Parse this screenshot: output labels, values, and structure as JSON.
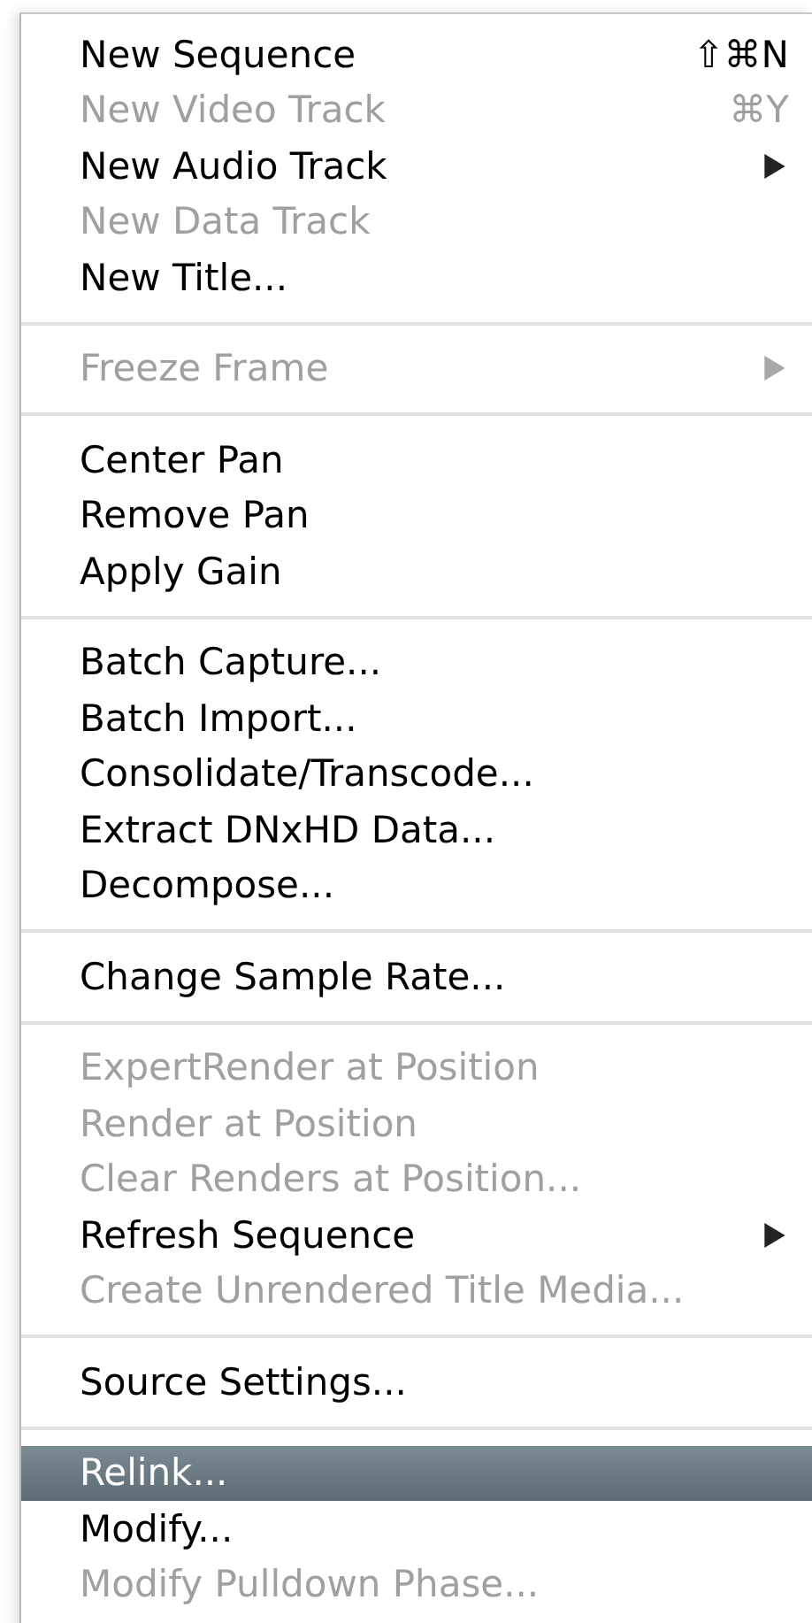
{
  "menu": {
    "items": [
      {
        "kind": "item",
        "label": "New Sequence",
        "shortcut": "⇧⌘N",
        "submenu": false,
        "disabled": false,
        "selected": false
      },
      {
        "kind": "item",
        "label": "New Video Track",
        "shortcut": "⌘Y",
        "submenu": false,
        "disabled": true,
        "selected": false
      },
      {
        "kind": "item",
        "label": "New Audio Track",
        "submenu": true,
        "disabled": false,
        "selected": false
      },
      {
        "kind": "item",
        "label": "New Data Track",
        "submenu": false,
        "disabled": true,
        "selected": false
      },
      {
        "kind": "item",
        "label": "New Title...",
        "submenu": false,
        "disabled": false,
        "selected": false
      },
      {
        "kind": "separator"
      },
      {
        "kind": "item",
        "label": "Freeze Frame",
        "submenu": true,
        "disabled": true,
        "selected": false
      },
      {
        "kind": "separator"
      },
      {
        "kind": "item",
        "label": "Center Pan",
        "submenu": false,
        "disabled": false,
        "selected": false
      },
      {
        "kind": "item",
        "label": "Remove Pan",
        "submenu": false,
        "disabled": false,
        "selected": false
      },
      {
        "kind": "item",
        "label": "Apply Gain",
        "submenu": false,
        "disabled": false,
        "selected": false
      },
      {
        "kind": "separator"
      },
      {
        "kind": "item",
        "label": "Batch Capture...",
        "submenu": false,
        "disabled": false,
        "selected": false
      },
      {
        "kind": "item",
        "label": "Batch Import...",
        "submenu": false,
        "disabled": false,
        "selected": false
      },
      {
        "kind": "item",
        "label": "Consolidate/Transcode...",
        "submenu": false,
        "disabled": false,
        "selected": false
      },
      {
        "kind": "item",
        "label": "Extract DNxHD Data...",
        "submenu": false,
        "disabled": false,
        "selected": false
      },
      {
        "kind": "item",
        "label": "Decompose...",
        "submenu": false,
        "disabled": false,
        "selected": false
      },
      {
        "kind": "separator"
      },
      {
        "kind": "item",
        "label": "Change Sample Rate...",
        "submenu": false,
        "disabled": false,
        "selected": false
      },
      {
        "kind": "separator"
      },
      {
        "kind": "item",
        "label": "ExpertRender at Position",
        "submenu": false,
        "disabled": true,
        "selected": false
      },
      {
        "kind": "item",
        "label": "Render at Position",
        "submenu": false,
        "disabled": true,
        "selected": false
      },
      {
        "kind": "item",
        "label": "Clear Renders at Position...",
        "submenu": false,
        "disabled": true,
        "selected": false
      },
      {
        "kind": "item",
        "label": "Refresh Sequence",
        "submenu": true,
        "disabled": false,
        "selected": false
      },
      {
        "kind": "item",
        "label": "Create Unrendered Title Media...",
        "submenu": false,
        "disabled": true,
        "selected": false
      },
      {
        "kind": "separator"
      },
      {
        "kind": "item",
        "label": "Source Settings...",
        "submenu": false,
        "disabled": false,
        "selected": false
      },
      {
        "kind": "separator"
      },
      {
        "kind": "item",
        "label": "Relink...",
        "submenu": false,
        "disabled": false,
        "selected": true
      },
      {
        "kind": "item",
        "label": "Modify...",
        "submenu": false,
        "disabled": false,
        "selected": false
      },
      {
        "kind": "item",
        "label": "Modify Pulldown Phase...",
        "submenu": false,
        "disabled": true,
        "selected": false
      }
    ]
  }
}
